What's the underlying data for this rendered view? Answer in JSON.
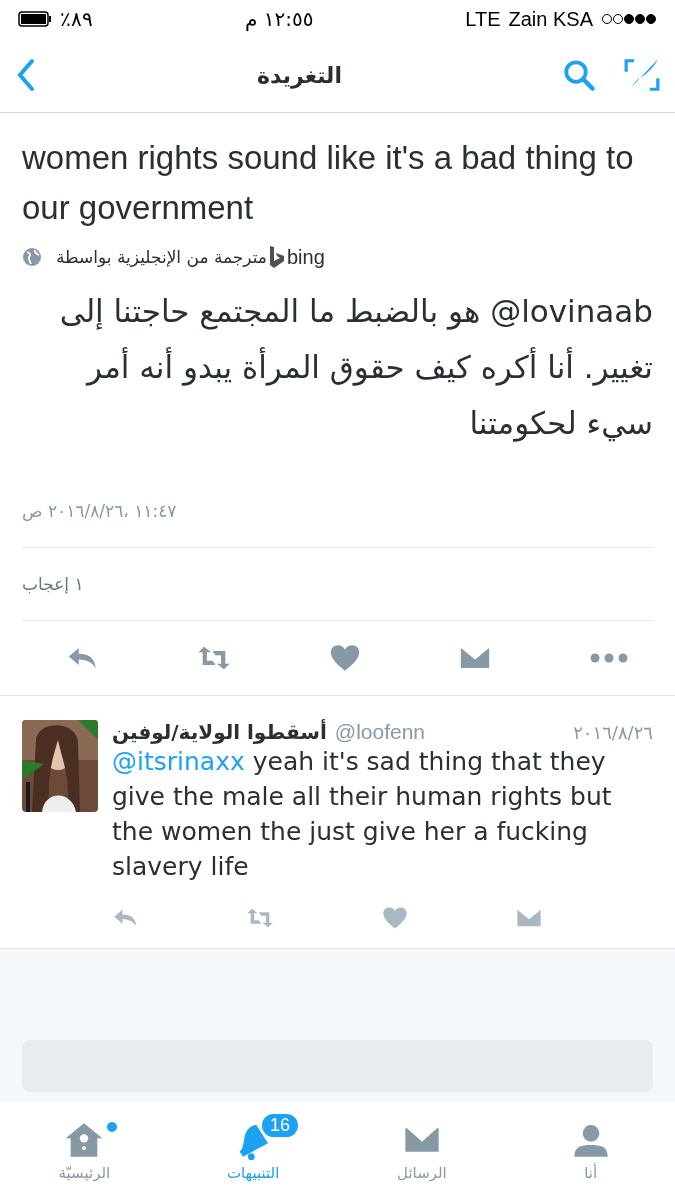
{
  "status_bar": {
    "battery": "٪٨٩",
    "time": "١٢:٥٥ م",
    "network": "LTE",
    "carrier": "Zain KSA"
  },
  "nav": {
    "title": "التغريدة"
  },
  "tweet": {
    "text": "women rights sound like it's a bad thing to our government",
    "translation": {
      "label": "مترجمة من الإنجليزية بواسطة",
      "provider": "bing"
    },
    "translated_text": "lovinaab@ هو بالضبط ما المجتمع حاجتنا إلى تغيير. أنا أكره كيف حقوق المرأة يبدو أنه أمر سيء لحكومتنا",
    "timestamp": "١١:٤٧ ،٢٠١٦/٨/٢٦ ص",
    "likes": "١ إعجاب"
  },
  "reply": {
    "name": "أسقطوا الولاية/لوفين",
    "handle": "@loofenn",
    "date": "٢٠١٦/٨/٢٦",
    "mention": "@itsrinaxx",
    "text": "yeah it's sad thing that they give the male all their human rights but the women the just give her a fucking slavery life"
  },
  "tab_bar": [
    {
      "label": "أنا",
      "kind": "person",
      "selected": false
    },
    {
      "label": "الرسائل",
      "kind": "mail",
      "selected": false
    },
    {
      "label": "التنبيهات",
      "kind": "bell",
      "selected": true,
      "badge": "16"
    },
    {
      "label": "الرئيسيّة",
      "kind": "home",
      "selected": false,
      "dot": true
    }
  ]
}
